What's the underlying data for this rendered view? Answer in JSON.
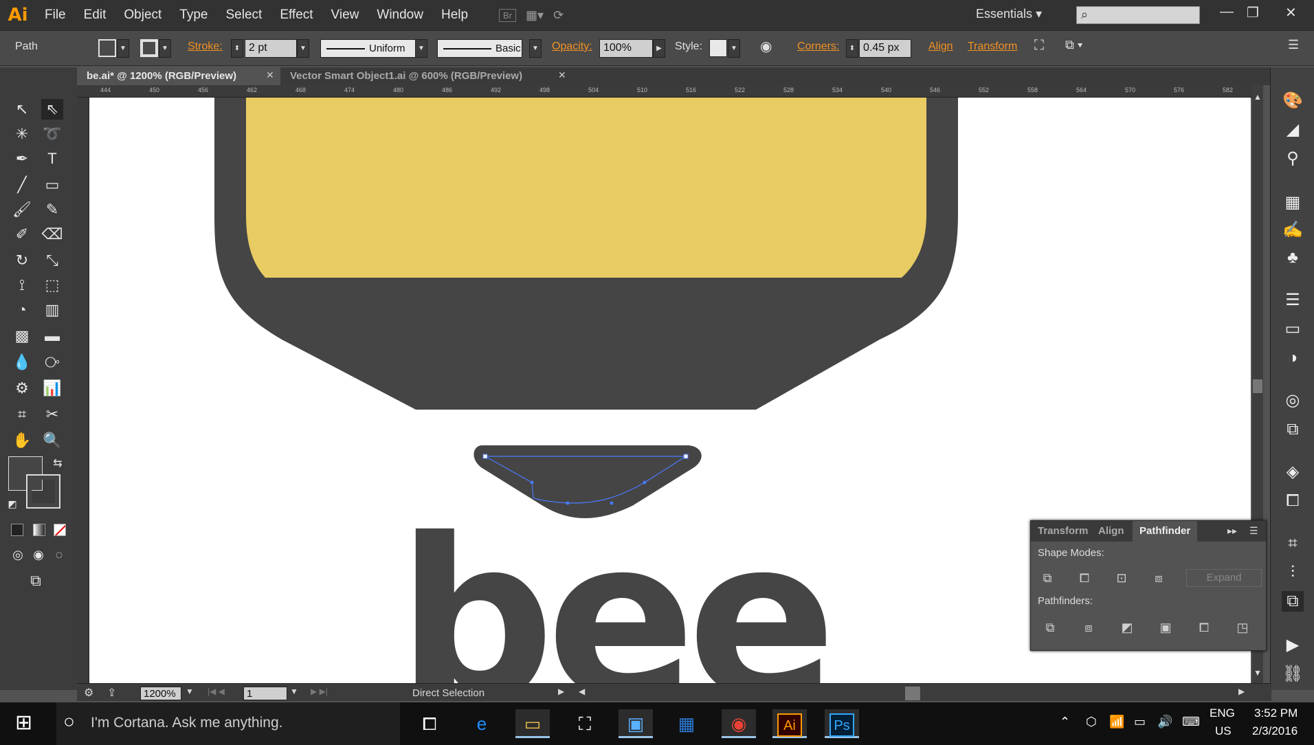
{
  "app": {
    "logo": "Ai"
  },
  "menu": [
    "File",
    "Edit",
    "Object",
    "Type",
    "Select",
    "Effect",
    "View",
    "Window",
    "Help"
  ],
  "menubar_icons": {
    "bridge": "Br",
    "arrange": "arrange-documents-icon",
    "gpu": "gpu-performance-icon"
  },
  "workspace": {
    "label": "Essentials"
  },
  "search": {
    "placeholder": ""
  },
  "control": {
    "selection_type": "Path",
    "stroke_label": "Stroke:",
    "stroke_weight": "2 pt",
    "profile": "Uniform",
    "brush": "Basic",
    "opacity_label": "Opacity:",
    "opacity": "100%",
    "style_label": "Style:",
    "corners_label": "Corners:",
    "corners": "0.45 px",
    "align_label": "Align",
    "transform_label": "Transform"
  },
  "tabs": [
    {
      "label": "be.ai* @ 1200% (RGB/Preview)",
      "active": true
    },
    {
      "label": "Vector Smart Object1.ai @ 600% (RGB/Preview)",
      "active": false
    }
  ],
  "ruler_h": [
    "444",
    "450",
    "456",
    "462",
    "468",
    "474",
    "480",
    "486",
    "492",
    "498",
    "504",
    "510",
    "516",
    "522",
    "528",
    "534",
    "540",
    "546",
    "552",
    "558",
    "564",
    "570",
    "576",
    "582"
  ],
  "artwork": {
    "text": "bee",
    "body_color": "#454545",
    "fill_color": "#e8cc63",
    "path_color": "#4a7aff"
  },
  "pathfinder": {
    "tabs": [
      "Transform",
      "Align",
      "Pathfinder"
    ],
    "active_tab": "Pathfinder",
    "shape_modes_label": "Shape Modes:",
    "pathfinders_label": "Pathfinders:",
    "expand_label": "Expand"
  },
  "status": {
    "zoom": "1200%",
    "artboard": "1",
    "tool": "Direct Selection"
  },
  "taskbar": {
    "cortana": "I'm Cortana. Ask me anything.",
    "lang": "ENG",
    "region": "US",
    "time": "3:52 PM",
    "date": "2/3/2016",
    "apps": [
      "task-view-icon",
      "edge-icon",
      "file-explorer-icon",
      "store-icon",
      "lenovo-icon",
      "app-icon",
      "chrome-icon",
      "illustrator-icon",
      "photoshop-icon"
    ],
    "ai_label": "Ai",
    "ps_label": "Ps"
  }
}
